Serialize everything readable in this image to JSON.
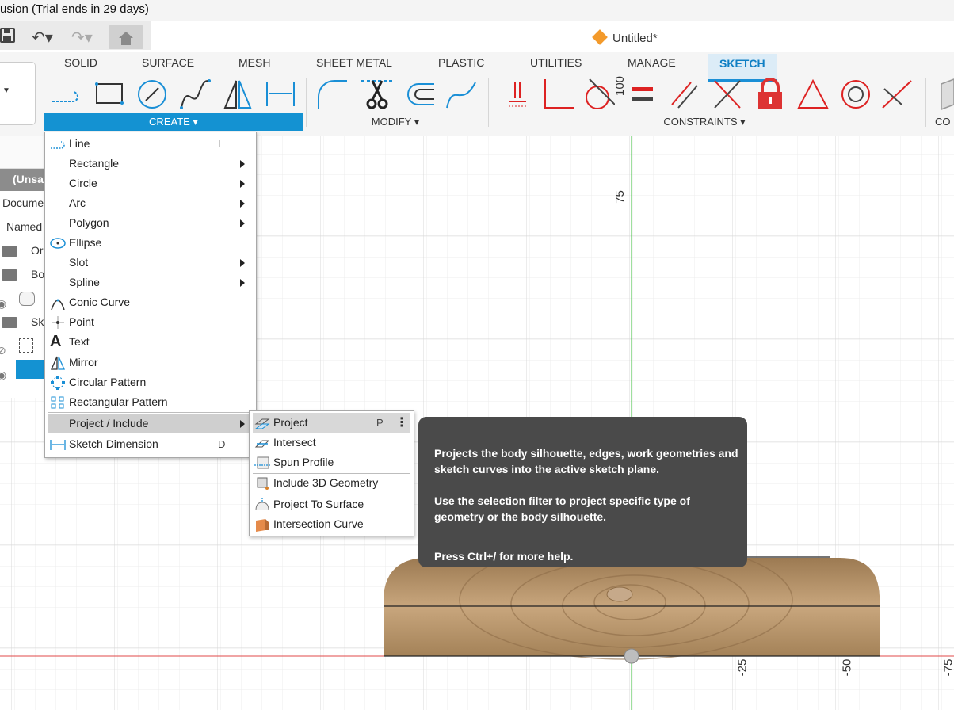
{
  "window": {
    "title": "usion (Trial ends in 29 days)"
  },
  "document_tab": {
    "label": "Untitled*"
  },
  "ribbon": {
    "tabs": [
      {
        "label": "SOLID"
      },
      {
        "label": "SURFACE"
      },
      {
        "label": "MESH"
      },
      {
        "label": "SHEET METAL"
      },
      {
        "label": "PLASTIC"
      },
      {
        "label": "UTILITIES"
      },
      {
        "label": "MANAGE"
      },
      {
        "label": "SKETCH",
        "active": true
      }
    ],
    "groups": {
      "create": "CREATE ▾",
      "modify": "MODIFY ▾",
      "constraints": "CONSTRAINTS ▾",
      "co": "CO"
    }
  },
  "browser": {
    "rows": [
      "(Unsa",
      "Docume",
      "Named",
      "Or",
      "Bo",
      "Sk"
    ]
  },
  "create_menu": {
    "items": [
      {
        "label": "Line",
        "shortcut": "L",
        "icon": "line-icon"
      },
      {
        "label": "Rectangle",
        "submenu": true
      },
      {
        "label": "Circle",
        "submenu": true
      },
      {
        "label": "Arc",
        "submenu": true
      },
      {
        "label": "Polygon",
        "submenu": true
      },
      {
        "label": "Ellipse",
        "icon": "ellipse-icon"
      },
      {
        "label": "Slot",
        "submenu": true
      },
      {
        "label": "Spline",
        "submenu": true
      },
      {
        "label": "Conic Curve",
        "icon": "conic-curve-icon"
      },
      {
        "label": "Point",
        "icon": "point-icon"
      },
      {
        "label": "Text",
        "icon": "text-icon"
      },
      {
        "label": "Mirror",
        "icon": "mirror-icon"
      },
      {
        "label": "Circular Pattern",
        "icon": "circular-pattern-icon"
      },
      {
        "label": "Rectangular Pattern",
        "icon": "rectangular-pattern-icon"
      },
      {
        "label": "Project / Include",
        "submenu": true,
        "highlighted": true
      },
      {
        "label": "Sketch Dimension",
        "shortcut": "D",
        "icon": "dimension-icon"
      }
    ]
  },
  "project_submenu": {
    "items": [
      {
        "label": "Project",
        "shortcut": "P",
        "highlighted": true
      },
      {
        "label": "Intersect"
      },
      {
        "label": "Spun Profile"
      },
      {
        "label": "Include 3D Geometry"
      },
      {
        "label": "Project To Surface"
      },
      {
        "label": "Intersection Curve"
      }
    ],
    "more_glyph": "⋮"
  },
  "tooltip": {
    "line1": "Projects the body silhouette, edges, work geometries and sketch curves into the active sketch plane.",
    "line2": "Use the selection filter to project specific type of geometry or the body silhouette.",
    "line3": "Press Ctrl+/ for more help."
  },
  "canvas": {
    "axis_labels": {
      "y100": "100",
      "y75": "75",
      "x_neg25": "-25",
      "x_neg50": "-50",
      "x_neg75": "-75"
    },
    "colors": {
      "grid_minor": "#ececec",
      "grid_major": "#d8d8d8",
      "axis_x": "#e04848",
      "axis_y": "#3cbf3c",
      "accent": "#1492d2",
      "wood": "#b08a5e"
    }
  }
}
